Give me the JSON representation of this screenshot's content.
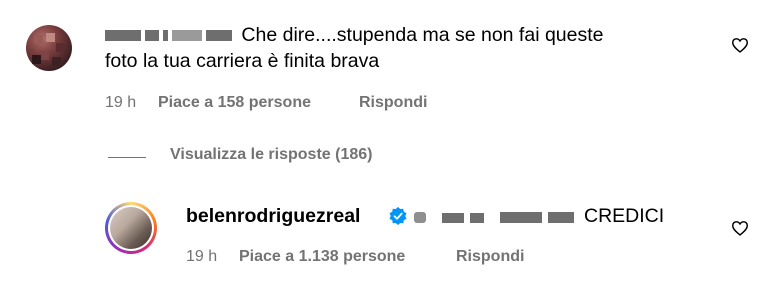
{
  "comment": {
    "text_line1": "Che dire....stupenda ma se non fai queste",
    "text_line2": "foto la tua carriera è finita brava",
    "time": "19 h",
    "likes": "Piace a 158 persone",
    "reply": "Rispondi"
  },
  "view_replies": "Visualizza le risposte (186)",
  "reply": {
    "username": "belenrodriguezreal",
    "text": "CREDICI",
    "time": "19 h",
    "likes": "Piace a 1.138 persone",
    "reply": "Rispondi"
  },
  "icons": {
    "like": "heart-icon",
    "verified": "verified-badge-icon"
  },
  "colors": {
    "text": "#000000",
    "secondary": "#737373",
    "verified": "#0095f6"
  }
}
